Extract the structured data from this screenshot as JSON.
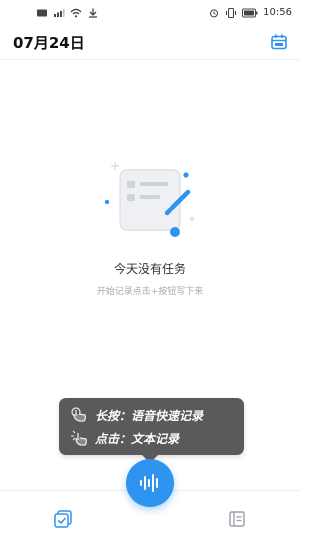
{
  "status_bar": {
    "time": "10:56",
    "left_icons": [
      "message-icon",
      "signal-icon",
      "wifi-icon",
      "download-icon"
    ],
    "right_icons": [
      "alarm-icon",
      "vibrate-icon",
      "battery-icon"
    ]
  },
  "header": {
    "date": "07月24日"
  },
  "empty_state": {
    "title": "今天没有任务",
    "hint": "开始记录点击+按钮写下来"
  },
  "tooltip": {
    "long_press": "长按：语音快速记录",
    "tap": "点击：文本记录"
  },
  "bottom_nav": {
    "left_tab_icon": "tasks-icon",
    "center_icon": "voice-icon",
    "right_tab_icon": "notes-icon"
  },
  "colors": {
    "accent": "#2f93f0",
    "tooltip_bg": "#5a5a5a"
  }
}
